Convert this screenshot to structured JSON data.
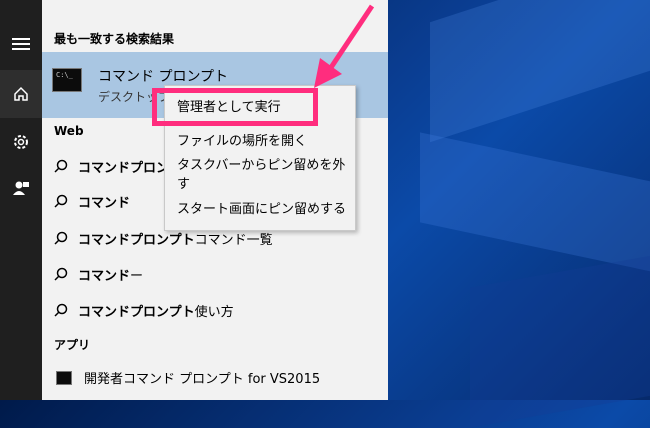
{
  "search": {
    "header": "最も一致する検索結果",
    "best_match": {
      "title": "コマンド プロンプト",
      "subtitle": "デスクトップ",
      "icon": "cmd-icon"
    },
    "section_web": "Web",
    "web_results": [
      {
        "bold": "コマンドプロンプ",
        "rest": ""
      },
      {
        "bold": "コマンド",
        "rest": ""
      },
      {
        "bold": "コマンドプロンプト",
        "rest": " コマンド一覧"
      },
      {
        "bold": "コマンド",
        "rest": "ー"
      },
      {
        "bold": "コマンドプロンプト",
        "rest": " 使い方"
      }
    ],
    "section_apps": "アプリ",
    "app_results": [
      {
        "label": "開発者コマンド プロンプト for VS2015"
      }
    ]
  },
  "context_menu": {
    "items": [
      "管理者として実行",
      "ファイルの場所を開く",
      "タスクバーからピン留めを外す",
      "スタート画面にピン留めする"
    ]
  },
  "rail": {
    "icons": [
      "hamburger-icon",
      "home-icon",
      "gear-icon",
      "feedback-icon"
    ]
  },
  "colors": {
    "highlight": "#ff2d7e",
    "selected": "#a9c6e2"
  }
}
